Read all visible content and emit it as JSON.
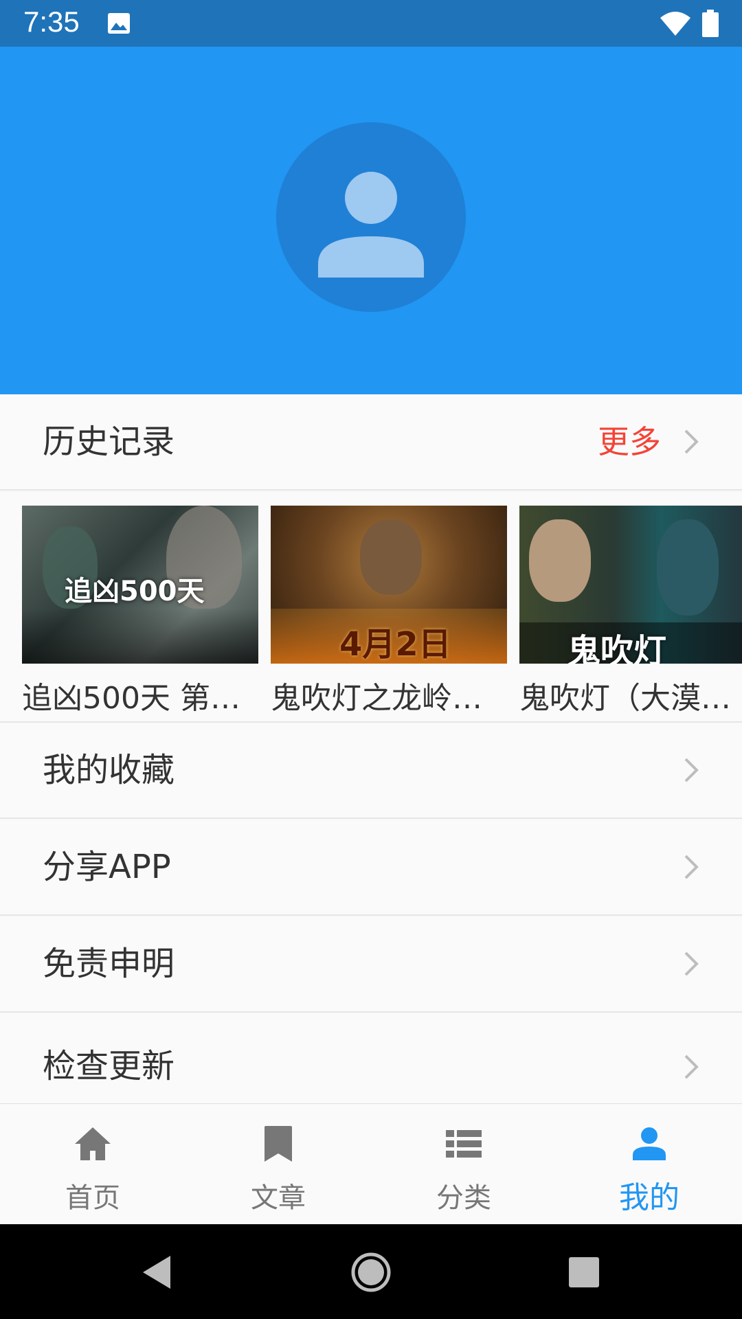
{
  "status_bar": {
    "time": "7:35",
    "icons": [
      "image-icon",
      "wifi-icon",
      "battery-icon"
    ]
  },
  "header": {
    "avatar_icon": "person-icon",
    "background_color": "#2196f3"
  },
  "history": {
    "title": "历史记录",
    "more_label": "更多",
    "items": [
      {
        "title": "追凶500天 第0…",
        "poster_text": "追凶500天"
      },
      {
        "title": "鬼吹灯之龙岭…",
        "poster_text": "4月2日"
      },
      {
        "title": "鬼吹灯（大漠…",
        "poster_text": "鬼吹灯"
      }
    ]
  },
  "menu": {
    "items": [
      {
        "label": "我的收藏"
      },
      {
        "label": "分享APP"
      },
      {
        "label": "免责申明"
      },
      {
        "label": "检查更新"
      }
    ]
  },
  "bottom_nav": {
    "items": [
      {
        "label": "首页",
        "icon": "home-icon",
        "active": false
      },
      {
        "label": "文章",
        "icon": "bookmark-icon",
        "active": false
      },
      {
        "label": "分类",
        "icon": "list-icon",
        "active": false
      },
      {
        "label": "我的",
        "icon": "person-icon",
        "active": true
      }
    ]
  },
  "colors": {
    "status_bar": "#1f73b9",
    "accent": "#2196f3",
    "more": "#f44336"
  }
}
